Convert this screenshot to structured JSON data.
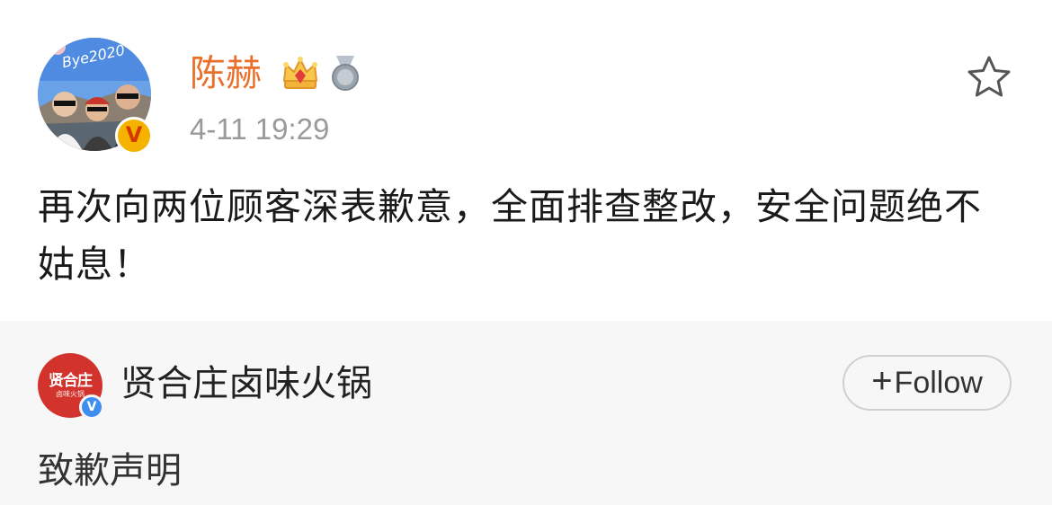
{
  "post": {
    "author": {
      "name": "陈赫",
      "avatar_text": "Bye2020",
      "verified_badge": "V",
      "badges": [
        "crown-icon",
        "medal-icon"
      ]
    },
    "timestamp": "4-11 19:29",
    "text": "再次向两位顾客深表歉意，全面排查整改，安全问题绝不姑息！",
    "favorite_icon": "star-outline-icon"
  },
  "repost": {
    "author": {
      "name": "贤合庄卤味火锅",
      "logo_main": "贤合庄",
      "logo_sub": "卤味火锅",
      "verified_badge": "V"
    },
    "follow_label": "Follow",
    "follow_plus": "+",
    "text": "致歉声明"
  },
  "colors": {
    "username": "#e8702a",
    "timestamp": "#9a9a9a",
    "repost_background": "#f7f7f7",
    "shop_logo": "#d2332c",
    "verified_blue": "#3e8ef0",
    "verified_gold": "#f5b300"
  }
}
